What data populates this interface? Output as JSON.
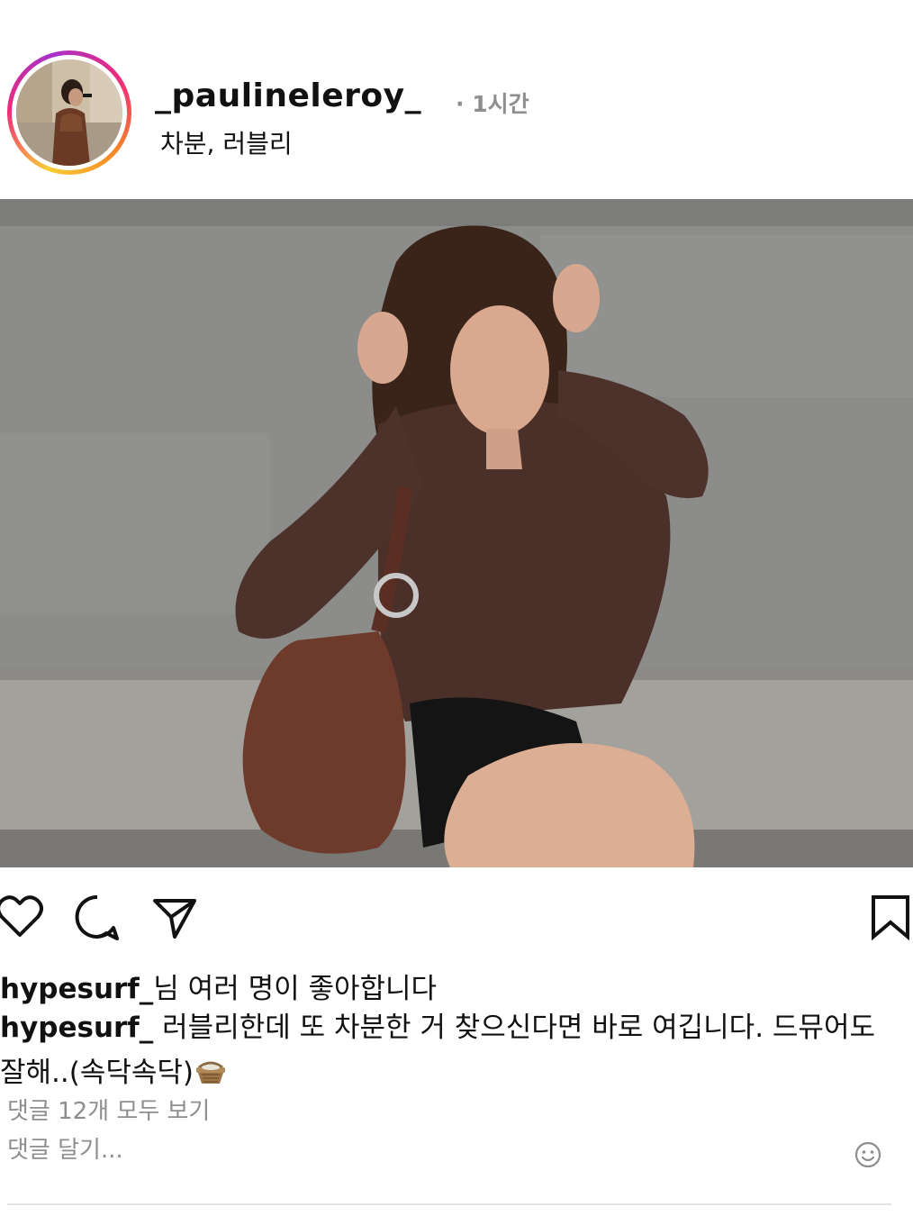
{
  "post": {
    "username": "_paulineleroy_",
    "time_ago": "· 1시간",
    "tagline": "차분, 러블리",
    "photo_alt": "Woman in brown ruched shirt sitting on a curb with a brown leather bag"
  },
  "actions": {
    "like_icon": "heart-icon",
    "comment_icon": "comment-icon",
    "share_icon": "send-icon",
    "save_icon": "bookmark-icon"
  },
  "likes": {
    "user": "hypesurf_",
    "text": "님 여러 명이 좋아합니다"
  },
  "caption": {
    "user": "hypesurf_",
    "text": " 러블리한데 또 차분한 거 찾으신다면 바로 여깁니다. 드뮤어도 잘해..(속닥속닥)"
  },
  "comments": {
    "view_all": "댓글 12개 모두 보기",
    "add_placeholder": "댓글 달기..."
  },
  "colors": {
    "text": "#111111",
    "muted": "#8e8e8e",
    "divider": "#e3e3e3"
  }
}
